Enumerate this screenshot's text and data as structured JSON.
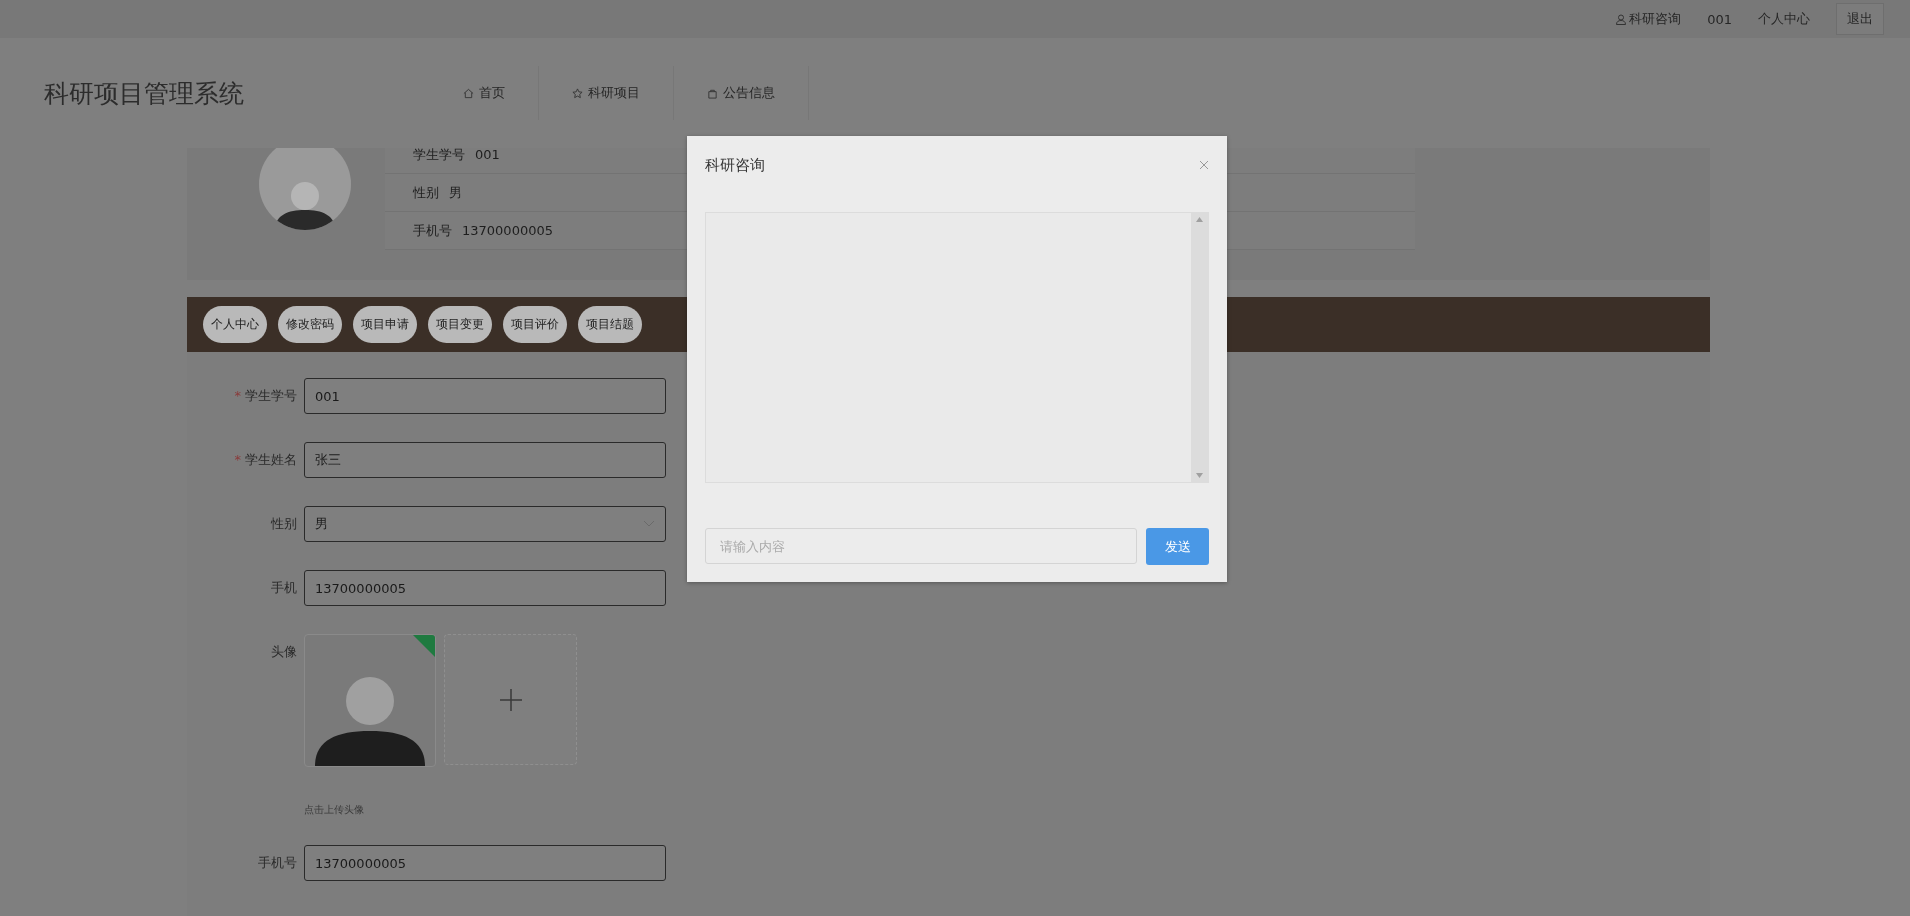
{
  "top_bar": {
    "links": [
      {
        "label": "科研咨询",
        "kind": "icon"
      },
      {
        "label": "001",
        "kind": "text"
      },
      {
        "label": "个人中心",
        "kind": "text"
      },
      {
        "label": "退出",
        "kind": "button"
      }
    ]
  },
  "header": {
    "title": "科研项目管理系统",
    "nav": [
      {
        "label": "首页",
        "kind": "home"
      },
      {
        "label": "科研项目",
        "kind": "star"
      },
      {
        "label": "公告信息",
        "kind": "bag"
      }
    ]
  },
  "profile": {
    "rows": [
      {
        "label": "学生学号",
        "value": "001"
      },
      {
        "label": "性别",
        "value": "男"
      },
      {
        "label": "手机号",
        "value": "13700000005"
      }
    ]
  },
  "tabs": [
    "个人中心",
    "修改密码",
    "项目申请",
    "项目变更",
    "项目评价",
    "项目结题"
  ],
  "form": {
    "required_mark": "*",
    "fields": [
      {
        "kind": "input",
        "label": "学生学号",
        "value": "001",
        "required": true
      },
      {
        "kind": "input",
        "label": "学生姓名",
        "value": "张三",
        "required": true
      },
      {
        "kind": "select",
        "label": "性别",
        "value": "男",
        "required": false
      },
      {
        "kind": "input",
        "label": "手机",
        "value": "13700000005",
        "required": false
      },
      {
        "kind": "upload",
        "label": "头像",
        "hint": "点击上传头像",
        "uploaded": true,
        "required": false
      },
      {
        "kind": "input",
        "label": "手机号",
        "value": "13700000005",
        "required": false
      }
    ]
  },
  "dialog": {
    "title": "科研咨询",
    "input": {
      "placeholder": "请输入内容"
    },
    "send": "发送"
  }
}
